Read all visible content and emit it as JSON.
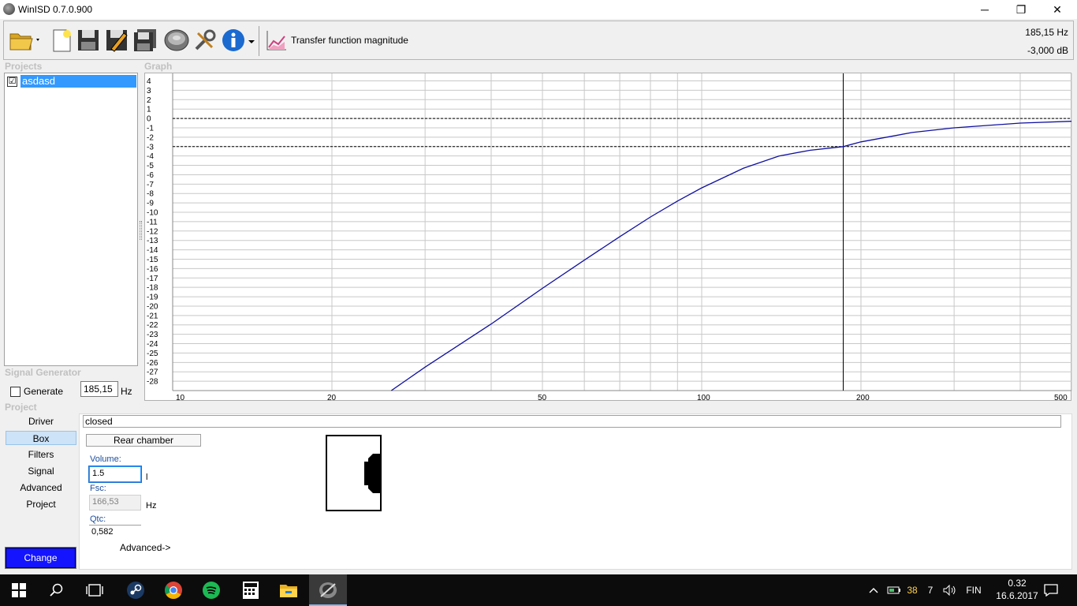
{
  "window": {
    "title": "WinISD 0.7.0.900",
    "minimize": "─",
    "maximize": "❐",
    "close": "✕"
  },
  "toolbar": {
    "icons": [
      "open-folder-icon",
      "new-project-icon",
      "save-icon",
      "save-as-icon",
      "save-all-icon",
      "driver-icon",
      "tools-icon",
      "info-icon",
      "chart-icon"
    ],
    "graph_selector": "Transfer function magnitude",
    "readout_freq": "185,15 Hz",
    "readout_db": "-3,000 dB"
  },
  "projects": {
    "label": "Projects",
    "items": [
      {
        "name": "asdasd",
        "checked": "☑"
      }
    ]
  },
  "graph": {
    "label": "Graph"
  },
  "signal_generator": {
    "label": "Signal Generator",
    "generate_label": "Generate",
    "frequency": "185,15",
    "unit": "Hz"
  },
  "project": {
    "label": "Project",
    "nav": [
      "Driver",
      "Box",
      "Filters",
      "Signal",
      "Advanced",
      "Project"
    ],
    "selected": "Box",
    "change_label": "Change",
    "box_type": "closed",
    "rear_chamber_label": "Rear chamber",
    "volume_label": "Volume:",
    "volume_value": "1.5",
    "volume_unit": "l",
    "fsc_label": "Fsc:",
    "fsc_value": "166,53",
    "fsc_unit": "Hz",
    "qtc_label": "Qtc:",
    "qtc_value": "0,582",
    "advanced_label": "Advanced->"
  },
  "chart_data": {
    "type": "line",
    "title": "",
    "xlabel": "",
    "ylabel": "",
    "xscale": "log",
    "xlim": [
      10,
      500
    ],
    "ylim": [
      -29,
      4.8
    ],
    "x_tick_labels": [
      "10",
      "20",
      "50",
      "100",
      "200",
      "500"
    ],
    "x_ticks": [
      10,
      20,
      50,
      100,
      200,
      500
    ],
    "y_tick_labels": [
      "4",
      "3",
      "2",
      "1",
      "0",
      "-1",
      "-2",
      "-3",
      "-4",
      "-5",
      "-6",
      "-7",
      "-8",
      "-9",
      "-10",
      "-11",
      "-12",
      "-13",
      "-14",
      "-15",
      "-16",
      "-17",
      "-18",
      "-19",
      "-20",
      "-21",
      "-22",
      "-23",
      "-24",
      "-25",
      "-26",
      "-27",
      "-28"
    ],
    "grid": true,
    "reference_lines_db": [
      0,
      -3
    ],
    "cursor_freq": 185.15,
    "series": [
      {
        "color": "#1010a0",
        "x": [
          25.9,
          30,
          40,
          50,
          60,
          70,
          80,
          90,
          100,
          120,
          140,
          160,
          185.15,
          200,
          250,
          300,
          400,
          500
        ],
        "y": [
          -29.0,
          -26.5,
          -21.9,
          -18.1,
          -15.1,
          -12.6,
          -10.5,
          -8.8,
          -7.4,
          -5.3,
          -4.0,
          -3.4,
          -3.0,
          -2.5,
          -1.5,
          -1.0,
          -0.5,
          -0.3
        ]
      }
    ]
  },
  "taskbar": {
    "apps": [
      "windows-start-icon",
      "search-icon",
      "task-view-icon",
      "steam-icon",
      "chrome-icon",
      "spotify-icon",
      "calculator-icon",
      "file-explorer-icon",
      "winisd-icon"
    ],
    "tray_num1": "38",
    "tray_num2": "7",
    "language": "FIN",
    "time": "0.32",
    "date": "16.6.2017"
  }
}
